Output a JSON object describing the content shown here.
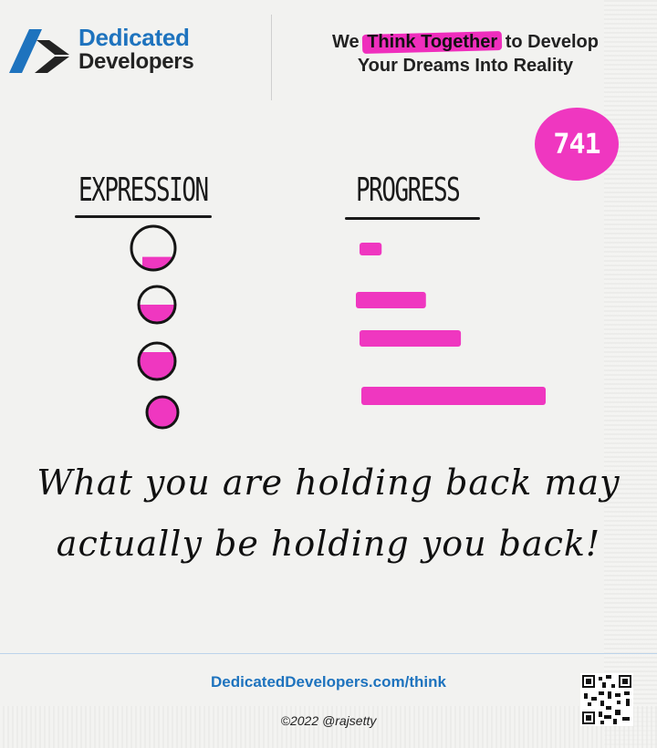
{
  "brand": {
    "line1": "Dedicated",
    "line2": "Developers",
    "logo_icon": "dd-logo-icon",
    "primary_color": "#1e73be",
    "dark_color": "#232323"
  },
  "tagline": {
    "part1": "We ",
    "highlight": "Think Together",
    "part2": " to Develop",
    "line2": "Your Dreams Into Reality",
    "highlight_color": "#ef2ebd"
  },
  "badge": {
    "number": "741",
    "color": "#ef37c0"
  },
  "illustration": {
    "expression_title": "EXPRESSION",
    "progress_title": "PROGRESS",
    "expression_fill_levels": [
      0.3,
      0.5,
      0.75,
      1.0
    ],
    "progress_levels": [
      0.12,
      0.38,
      0.55,
      1.0
    ],
    "accent_color": "#ef37c0"
  },
  "quote": {
    "line1": "What you are holding back may",
    "line2": "actually be holding you back!"
  },
  "footer": {
    "url": "DedicatedDevelopers.com/think",
    "copyright": "©2022 @rajsetty",
    "qr_icon": "qr-code-icon"
  }
}
